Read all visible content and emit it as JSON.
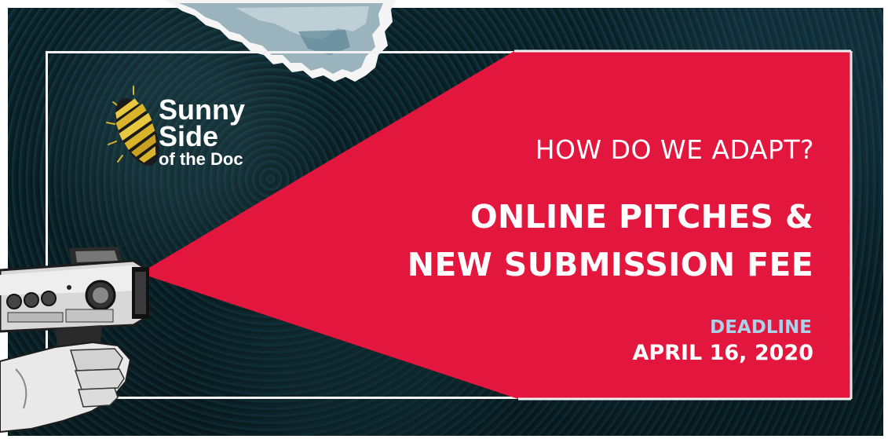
{
  "logo": {
    "line1": "Sunny",
    "line2": "Side",
    "line3": "of the Doc"
  },
  "headline": {
    "question": "HOW DO WE ADAPT?",
    "line1": "ONLINE PITCHES &",
    "line2": "NEW SUBMISSION FEE"
  },
  "deadline": {
    "label": "DEADLINE",
    "date": "APRIL 16, 2020"
  },
  "colors": {
    "beam": "#e3173e",
    "frame": "#f2f2f2",
    "deadline_label": "#a9d3ea",
    "logo_gold": "#d9b42a"
  }
}
